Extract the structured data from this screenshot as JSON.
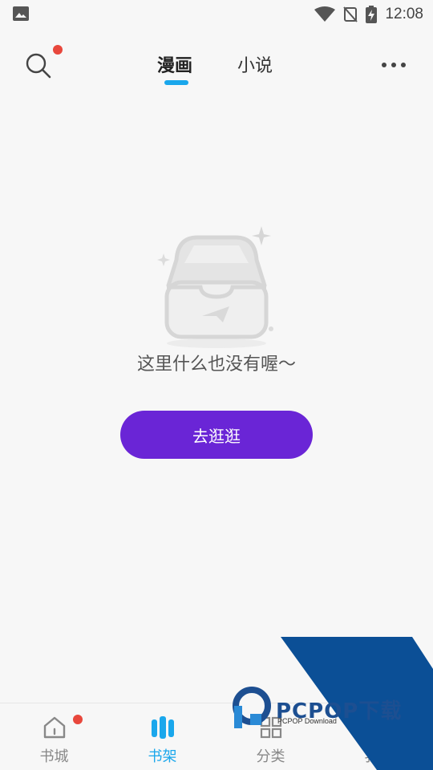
{
  "status_bar": {
    "time": "12:08"
  },
  "top_bar": {
    "tabs": [
      {
        "label": "漫画",
        "active": true
      },
      {
        "label": "小说",
        "active": false
      }
    ]
  },
  "empty_state": {
    "message": "这里什么也没有喔～",
    "button_label": "去逛逛"
  },
  "bottom_nav": {
    "items": [
      {
        "label": "书城",
        "icon": "home-icon",
        "active": false,
        "badge": true
      },
      {
        "label": "书架",
        "icon": "bookshelf-icon",
        "active": true
      },
      {
        "label": "分类",
        "icon": "category-icon",
        "active": false
      },
      {
        "label": "我的",
        "icon": "profile-icon",
        "active": false
      }
    ]
  },
  "watermark": {
    "text": "PCPOP下载",
    "sub": "PCPOP Download"
  },
  "colors": {
    "accent": "#1aa7ec",
    "button": "#6a25d6",
    "badge": "#e8473c",
    "background": "#f7f7f7"
  }
}
